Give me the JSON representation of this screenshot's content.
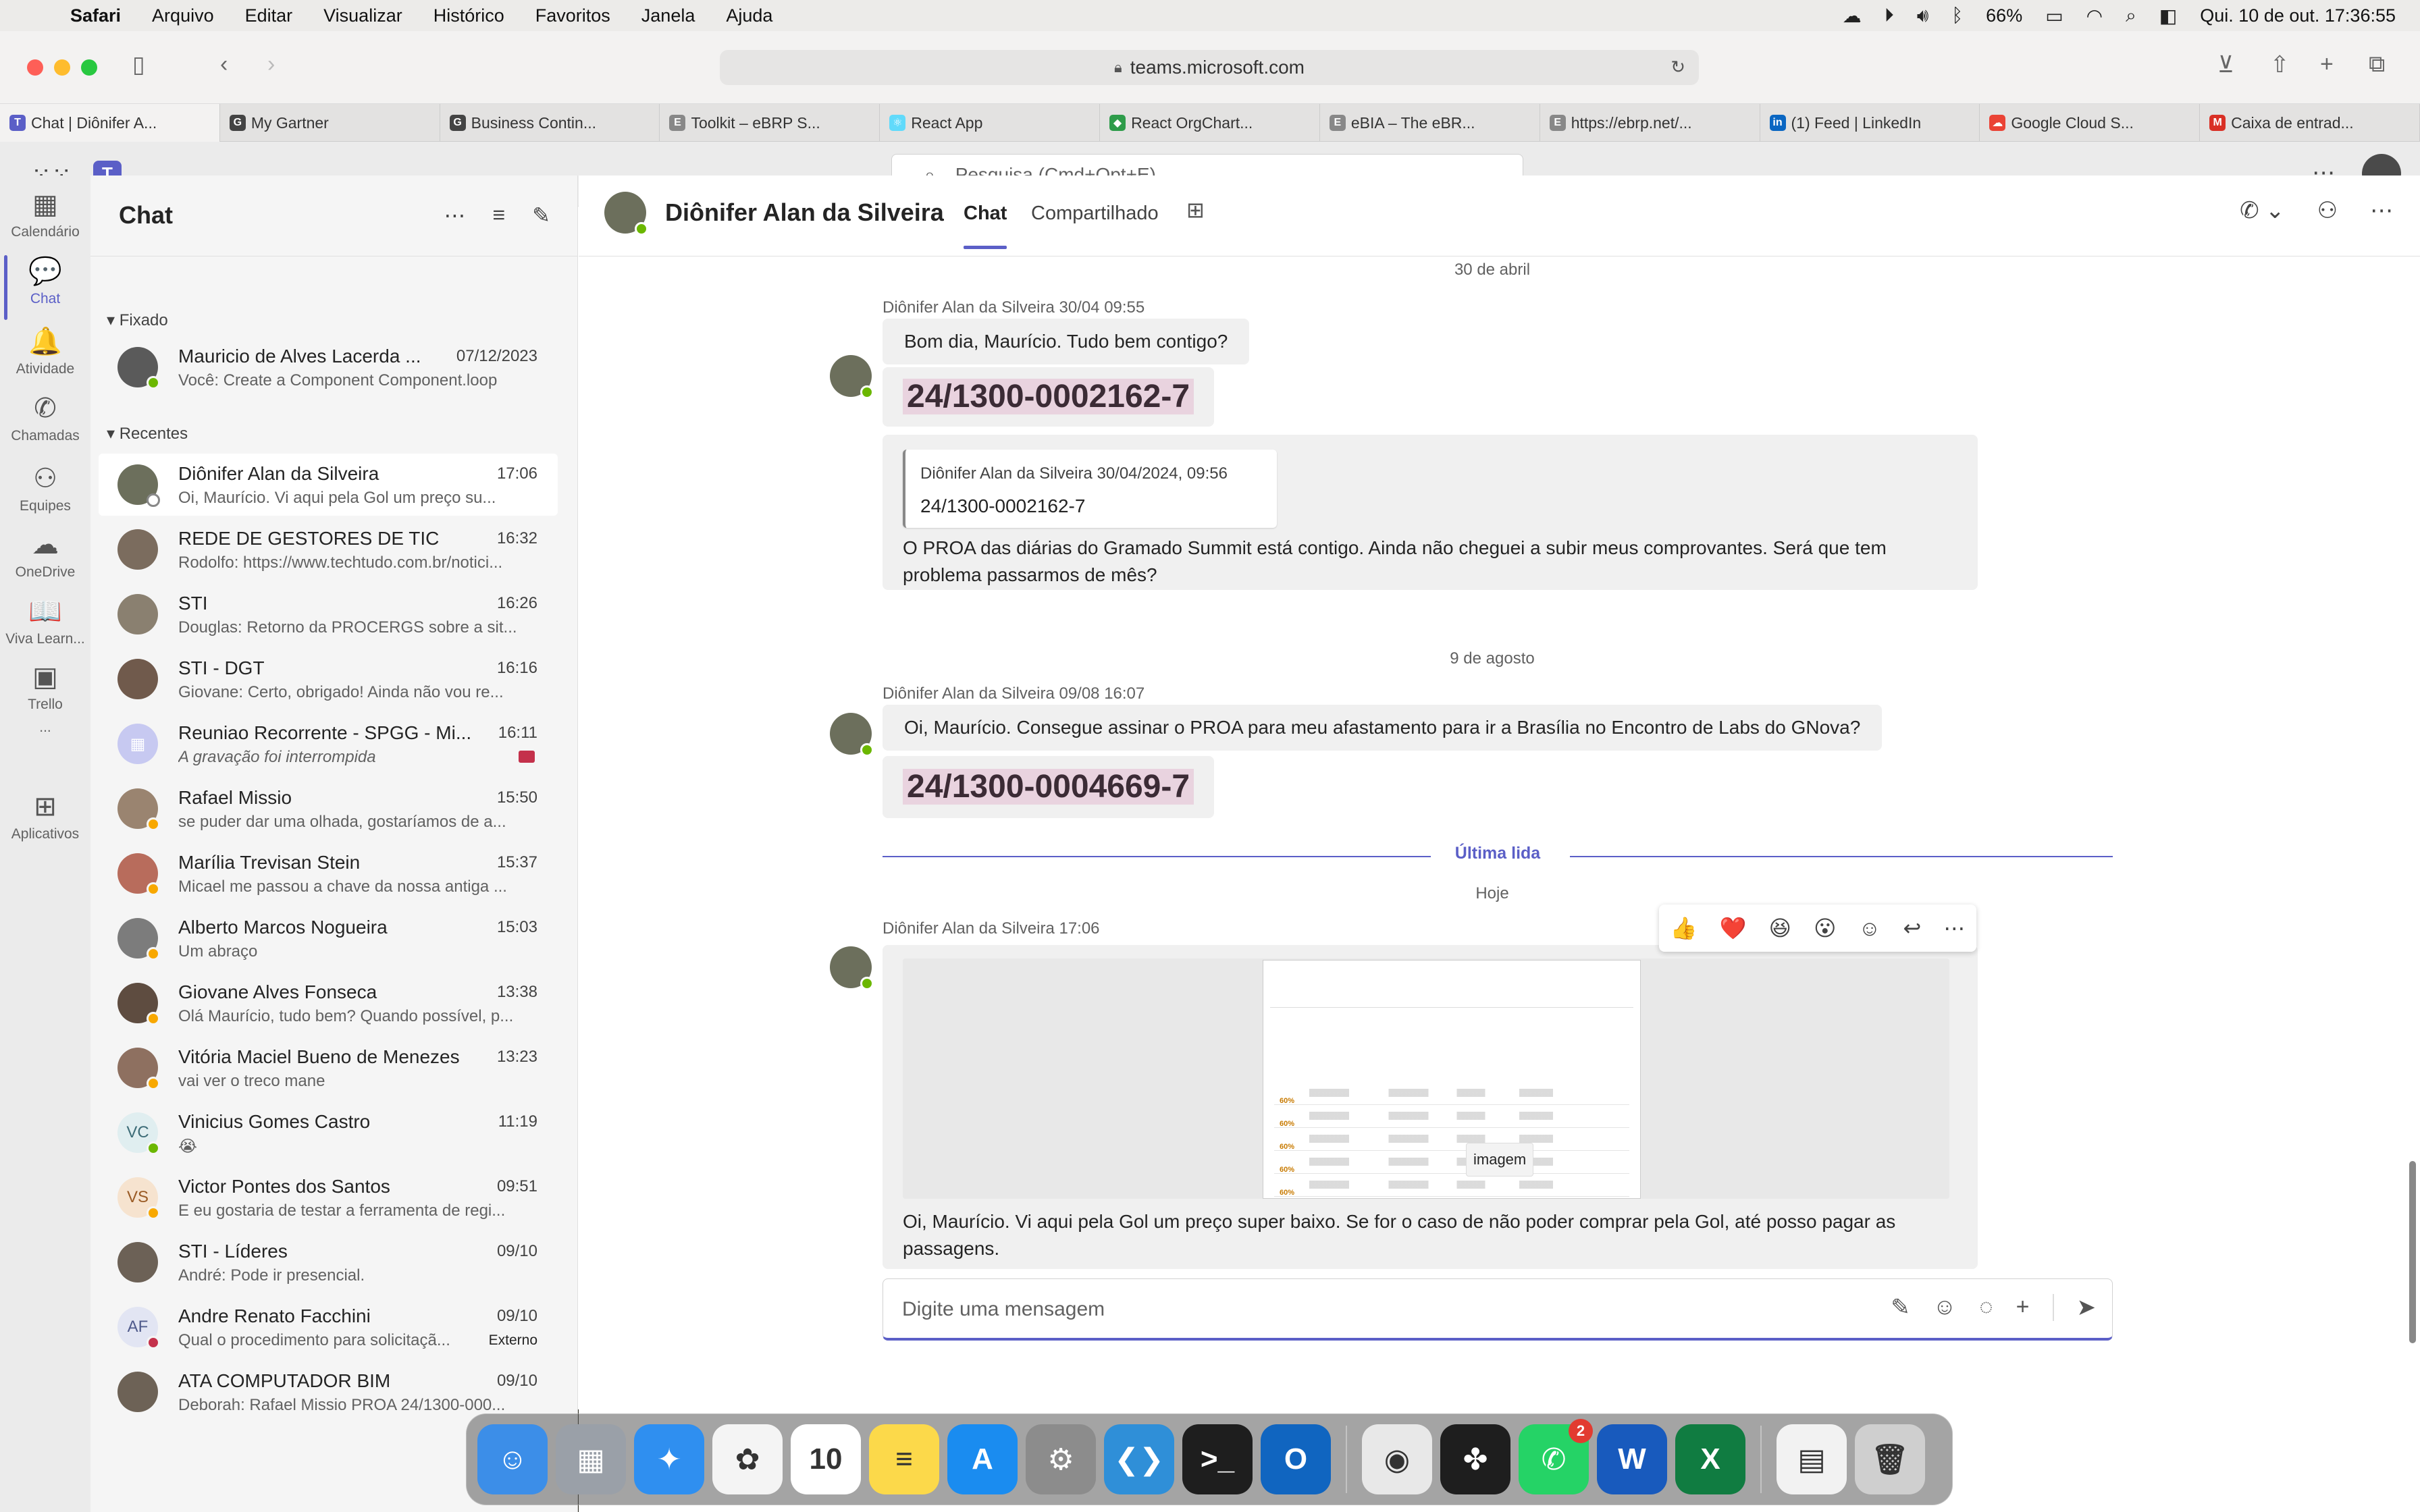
{
  "menubar": {
    "app": "Safari",
    "items": [
      "Arquivo",
      "Editar",
      "Visualizar",
      "Histórico",
      "Favoritos",
      "Janela",
      "Ajuda"
    ],
    "battery": "66%",
    "datetime": "Qui. 10 de out.  17:36:55"
  },
  "browser": {
    "url": "teams.microsoft.com",
    "tabs": [
      {
        "label": "Chat | Diônifer A...",
        "color": "#5b5fc7",
        "glyph": "T"
      },
      {
        "label": "My Gartner",
        "color": "#444",
        "glyph": "G"
      },
      {
        "label": "Business Contin...",
        "color": "#444",
        "glyph": "G"
      },
      {
        "label": "Toolkit – eBRP S...",
        "color": "#888",
        "glyph": "E"
      },
      {
        "label": "React App",
        "color": "#61dafb",
        "glyph": "⚛"
      },
      {
        "label": "React OrgChart...",
        "color": "#2e9c4a",
        "glyph": "◆"
      },
      {
        "label": "eBIA – The eBR...",
        "color": "#888",
        "glyph": "E"
      },
      {
        "label": "https://ebrp.net/...",
        "color": "#888",
        "glyph": "E"
      },
      {
        "label": "(1) Feed | LinkedIn",
        "color": "#0a66c2",
        "glyph": "in"
      },
      {
        "label": "Google Cloud S...",
        "color": "#ea4335",
        "glyph": "☁"
      },
      {
        "label": "Caixa de entrad...",
        "color": "#d93025",
        "glyph": "M"
      }
    ]
  },
  "teams": {
    "search_placeholder": "Pesquisa (Cmd+Opt+E)",
    "rail": [
      {
        "label": "Calendário",
        "icon": "calendar-icon",
        "glyph": "▦"
      },
      {
        "label": "Chat",
        "icon": "chat-icon",
        "glyph": "💬"
      },
      {
        "label": "Atividade",
        "icon": "bell-icon",
        "glyph": "🔔"
      },
      {
        "label": "Chamadas",
        "icon": "phone-icon",
        "glyph": "✆"
      },
      {
        "label": "Equipes",
        "icon": "teams-icon",
        "glyph": "⚇"
      },
      {
        "label": "OneDrive",
        "icon": "cloud-icon",
        "glyph": "☁"
      },
      {
        "label": "Viva Learn...",
        "icon": "book-icon",
        "glyph": "📖"
      },
      {
        "label": "Trello",
        "icon": "trello-icon",
        "glyph": "▣"
      },
      {
        "label": "...",
        "icon": "more-icon",
        "glyph": ""
      },
      {
        "label": "Aplicativos",
        "icon": "plus-icon",
        "glyph": "⊞"
      }
    ],
    "chatlist": {
      "title": "Chat",
      "pinned_label": "Fixado",
      "recent_label": "Recentes",
      "pinned": [
        {
          "name": "Mauricio de Alves Lacerda ...",
          "time": "07/12/2023",
          "preview": "Você: Create a Component Component.loop",
          "status": "#6bb700",
          "avatar": "#5a5a5a",
          "initials": ""
        }
      ],
      "recent": [
        {
          "name": "Diônifer Alan da Silveira",
          "time": "17:06",
          "preview": " Oi, Maurício. Vi aqui pela Gol um preço su...",
          "status": "#ffffff",
          "avatar": "#6c6f5c",
          "initials": ""
        },
        {
          "name": "REDE DE GESTORES DE TIC",
          "time": "16:32",
          "preview": "Rodolfo: https://www.techtudo.com.br/notici...",
          "status": "",
          "avatar": "#7b6c5e",
          "initials": ""
        },
        {
          "name": "STI",
          "time": "16:26",
          "preview": "Douglas: Retorno da PROCERGS sobre a sit...",
          "status": "",
          "avatar": "#8a8070",
          "initials": ""
        },
        {
          "name": "STI - DGT",
          "time": "16:16",
          "preview": "Giovane: Certo, obrigado!  Ainda não vou re...",
          "status": "",
          "avatar": "#705a4c",
          "initials": ""
        },
        {
          "name": "Reuniao Recorrente - SPGG - Mi...",
          "time": "16:11",
          "preview": "A gravação foi interrompida",
          "status": "",
          "avatar": "#c7c9f1",
          "initials": "▦",
          "italic": true,
          "rec": true
        },
        {
          "name": "Rafael Missio",
          "time": "15:50",
          "preview": "se puder dar uma olhada, gostaríamos de a...",
          "status": "#f8a800",
          "avatar": "#9a8470",
          "initials": ""
        },
        {
          "name": "Marília Trevisan Stein",
          "time": "15:37",
          "preview": "Micael me passou a chave da nossa antiga ...",
          "status": "#f8a800",
          "avatar": "#b86c5c",
          "initials": ""
        },
        {
          "name": "Alberto Marcos Nogueira",
          "time": "15:03",
          "preview": "Um abraço",
          "status": "#f8a800",
          "avatar": "#7c7c7c",
          "initials": ""
        },
        {
          "name": "Giovane Alves Fonseca",
          "time": "13:38",
          "preview": "Olá Maurício, tudo bem? Quando possível, p...",
          "status": "#f8a800",
          "avatar": "#5e4c40",
          "initials": ""
        },
        {
          "name": "Vitória Maciel Bueno de Menezes",
          "time": "13:23",
          "preview": "vai ver o treco mane",
          "status": "#f8a800",
          "avatar": "#8e7060",
          "initials": ""
        },
        {
          "name": "Vinicius Gomes Castro",
          "time": "11:19",
          "preview": "😭",
          "status": "#6bb700",
          "avatar": "#e0eef0",
          "initials": "VC",
          "initials_color": "#3d6c77"
        },
        {
          "name": "Victor Pontes dos Santos",
          "time": "09:51",
          "preview": "E eu gostaria de testar a ferramenta de regi...",
          "status": "#f8a800",
          "avatar": "#f6e3cf",
          "initials": "VS",
          "initials_color": "#9a5b25"
        },
        {
          "name": "STI - Líderes",
          "time": "09/10",
          "preview": "André: Pode ir presencial.",
          "status": "",
          "avatar": "#6c6156",
          "initials": ""
        },
        {
          "name": "Andre Renato Facchini",
          "time": "09/10",
          "preview": "Qual o procedimento para solicitaçã...",
          "status": "#c4314b",
          "avatar": "#e2e5f3",
          "initials": "AF",
          "initials_color": "#4f5a8b",
          "external": "Externo"
        },
        {
          "name": "ATA COMPUTADOR BIM",
          "time": "09/10",
          "preview": "Deborah: Rafael Missio  PROA 24/1300-000...",
          "status": "",
          "avatar": "#6d6256",
          "initials": ""
        }
      ]
    },
    "conversation": {
      "name": "Diônifer Alan da Silveira",
      "tabs": [
        "Chat",
        "Compartilhado"
      ],
      "date1": "30 de abril",
      "msg1": {
        "sender": "Diônifer Alan da Silveira   30/04 09:55",
        "text": "Bom dia, Maurício. Tudo bem contigo?",
        "ticket": "24/1300-0002162-7",
        "quote_header": "Diônifer Alan da Silveira    30/04/2024, 09:56",
        "quote_body": "24/1300-0002162-7",
        "text2": " O PROA das diárias do Gramado Summit está contigo. Ainda não cheguei a subir meus comprovantes. Será que tem problema passarmos de mês?"
      },
      "date2": "9 de agosto",
      "msg2": {
        "sender": "Diônifer Alan da Silveira   09/08 16:07",
        "text": "Oi, Maurício. Consegue assinar o PROA para meu afastamento para ir a Brasília no Encontro de Labs do GNova?",
        "ticket": "24/1300-0004669-7"
      },
      "last_read": "Última lida",
      "date3": "Hoje",
      "msg3": {
        "sender": "Diônifer Alan da Silveira   17:06",
        "image_label": "imagem",
        "text": " Oi, Maurício. Vi aqui pela Gol um preço super baixo. Se for o caso de não poder comprar pela Gol, até posso pagar as passagens."
      },
      "reactions": [
        "👍",
        "❤️",
        "😆",
        "😮",
        "☺",
        "↩",
        "⋯"
      ],
      "composer_placeholder": "Digite uma mensagem"
    }
  },
  "dock": [
    {
      "name": "finder",
      "color": "#3c8ee8",
      "glyph": "☺"
    },
    {
      "name": "launchpad",
      "color": "#9aa0a8",
      "glyph": "▦"
    },
    {
      "name": "safari",
      "color": "#2f8ff0",
      "glyph": "✦"
    },
    {
      "name": "photos",
      "color": "#f4f4f4",
      "glyph": "✿"
    },
    {
      "name": "calendar",
      "color": "#ffffff",
      "glyph": "10"
    },
    {
      "name": "notes",
      "color": "#fcd94a",
      "glyph": "≡"
    },
    {
      "name": "app-store",
      "color": "#1a8cf0",
      "glyph": "A"
    },
    {
      "name": "system-settings",
      "color": "#8c8c8c",
      "glyph": "⚙"
    },
    {
      "name": "vscode",
      "color": "#2f8fd8",
      "glyph": "❮❯"
    },
    {
      "name": "terminal",
      "color": "#1e1e1e",
      "glyph": ">_"
    },
    {
      "name": "outlook",
      "color": "#1065c0",
      "glyph": "O"
    },
    {
      "name": "chrome",
      "color": "#e8e8e8",
      "glyph": "◉"
    },
    {
      "name": "figma",
      "color": "#1e1e1e",
      "glyph": "✤"
    },
    {
      "name": "whatsapp",
      "color": "#25d366",
      "glyph": "✆",
      "badge": "2"
    },
    {
      "name": "word",
      "color": "#185abd",
      "glyph": "W"
    },
    {
      "name": "excel",
      "color": "#107c41",
      "glyph": "X"
    },
    {
      "name": "docx-file",
      "color": "#f2f2f2",
      "glyph": "▤"
    },
    {
      "name": "trash",
      "color": "#cfcfcf",
      "glyph": "🗑"
    }
  ]
}
